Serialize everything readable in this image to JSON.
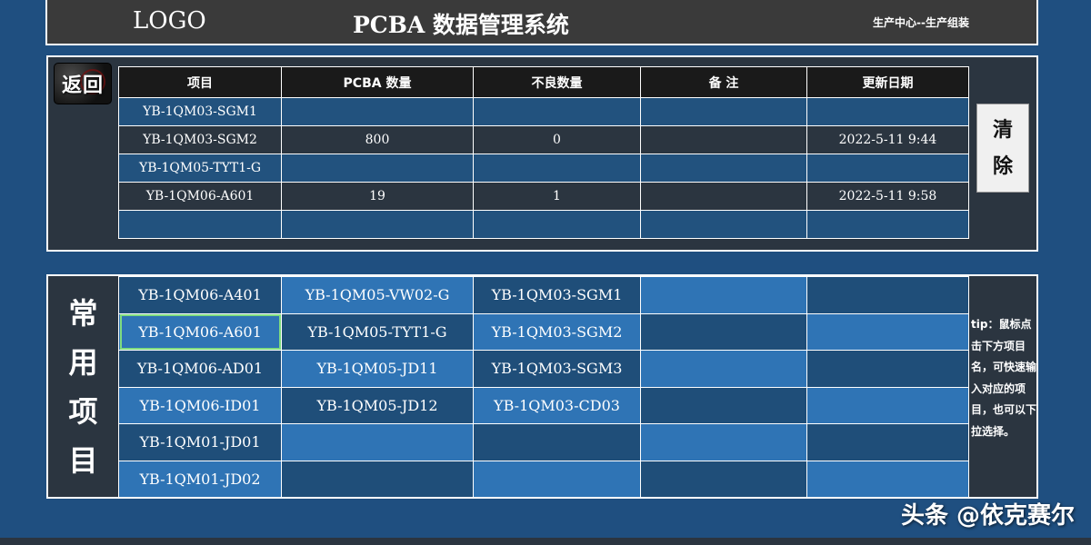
{
  "header": {
    "logo": "LOGO",
    "title": "PCBA 数据管理系统",
    "department": "生产中心--生产组装"
  },
  "back_button": {
    "label": "返回",
    "icon": "gauge-icon"
  },
  "clear_button": {
    "line1": "清",
    "line2": "除"
  },
  "summary_table": {
    "headers": [
      "项目",
      "PCBA 数量",
      "不良数量",
      "备 注",
      "更新日期"
    ],
    "rows": [
      [
        "YB-1QM03-SGM1",
        "",
        "",
        "",
        ""
      ],
      [
        "YB-1QM03-SGM2",
        "800",
        "0",
        "",
        "2022-5-11 9:44"
      ],
      [
        "YB-1QM05-TYT1-G",
        "",
        "",
        "",
        ""
      ],
      [
        "YB-1QM06-A601",
        "19",
        "1",
        "",
        "2022-5-11 9:58"
      ],
      [
        "",
        "",
        "",
        "",
        ""
      ]
    ]
  },
  "common_items": {
    "title_chars": [
      "常",
      "用",
      "项",
      "目"
    ],
    "columns": [
      [
        "YB-1QM06-A401",
        "YB-1QM06-A601",
        "YB-1QM06-AD01",
        "YB-1QM06-ID01",
        "YB-1QM01-JD01",
        "YB-1QM01-JD02"
      ],
      [
        "YB-1QM05-VW02-G",
        "YB-1QM05-TYT1-G",
        "YB-1QM05-JD11",
        "YB-1QM05-JD12",
        "",
        ""
      ],
      [
        "YB-1QM03-SGM1",
        "YB-1QM03-SGM2",
        "YB-1QM03-SGM3",
        "YB-1QM03-CD03",
        "",
        ""
      ],
      [
        "",
        "",
        "",
        "",
        "",
        ""
      ],
      [
        "",
        "",
        "",
        "",
        "",
        ""
      ]
    ],
    "selected": "YB-1QM06-A601"
  },
  "tip": "tip：鼠标点击下方项目名，可快速输入对应的项目，也可以下拉选择。",
  "watermark": "头条 @依克赛尔",
  "colors": {
    "background": "#1f4f80",
    "panel": "#2b3540",
    "cell_light": "#2f74b5",
    "cell_dark": "#1f4e79",
    "header_bar": "#3a3a3a"
  }
}
